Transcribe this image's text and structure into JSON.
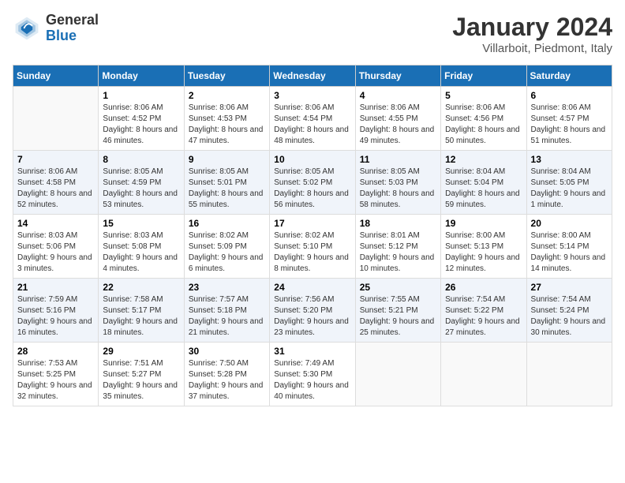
{
  "header": {
    "logo_line1": "General",
    "logo_line2": "Blue",
    "month": "January 2024",
    "location": "Villarboit, Piedmont, Italy"
  },
  "days_of_week": [
    "Sunday",
    "Monday",
    "Tuesday",
    "Wednesday",
    "Thursday",
    "Friday",
    "Saturday"
  ],
  "weeks": [
    [
      {
        "day": "",
        "sunrise": "",
        "sunset": "",
        "daylight": ""
      },
      {
        "day": "1",
        "sunrise": "Sunrise: 8:06 AM",
        "sunset": "Sunset: 4:52 PM",
        "daylight": "Daylight: 8 hours and 46 minutes."
      },
      {
        "day": "2",
        "sunrise": "Sunrise: 8:06 AM",
        "sunset": "Sunset: 4:53 PM",
        "daylight": "Daylight: 8 hours and 47 minutes."
      },
      {
        "day": "3",
        "sunrise": "Sunrise: 8:06 AM",
        "sunset": "Sunset: 4:54 PM",
        "daylight": "Daylight: 8 hours and 48 minutes."
      },
      {
        "day": "4",
        "sunrise": "Sunrise: 8:06 AM",
        "sunset": "Sunset: 4:55 PM",
        "daylight": "Daylight: 8 hours and 49 minutes."
      },
      {
        "day": "5",
        "sunrise": "Sunrise: 8:06 AM",
        "sunset": "Sunset: 4:56 PM",
        "daylight": "Daylight: 8 hours and 50 minutes."
      },
      {
        "day": "6",
        "sunrise": "Sunrise: 8:06 AM",
        "sunset": "Sunset: 4:57 PM",
        "daylight": "Daylight: 8 hours and 51 minutes."
      }
    ],
    [
      {
        "day": "7",
        "sunrise": "Sunrise: 8:06 AM",
        "sunset": "Sunset: 4:58 PM",
        "daylight": "Daylight: 8 hours and 52 minutes."
      },
      {
        "day": "8",
        "sunrise": "Sunrise: 8:05 AM",
        "sunset": "Sunset: 4:59 PM",
        "daylight": "Daylight: 8 hours and 53 minutes."
      },
      {
        "day": "9",
        "sunrise": "Sunrise: 8:05 AM",
        "sunset": "Sunset: 5:01 PM",
        "daylight": "Daylight: 8 hours and 55 minutes."
      },
      {
        "day": "10",
        "sunrise": "Sunrise: 8:05 AM",
        "sunset": "Sunset: 5:02 PM",
        "daylight": "Daylight: 8 hours and 56 minutes."
      },
      {
        "day": "11",
        "sunrise": "Sunrise: 8:05 AM",
        "sunset": "Sunset: 5:03 PM",
        "daylight": "Daylight: 8 hours and 58 minutes."
      },
      {
        "day": "12",
        "sunrise": "Sunrise: 8:04 AM",
        "sunset": "Sunset: 5:04 PM",
        "daylight": "Daylight: 8 hours and 59 minutes."
      },
      {
        "day": "13",
        "sunrise": "Sunrise: 8:04 AM",
        "sunset": "Sunset: 5:05 PM",
        "daylight": "Daylight: 9 hours and 1 minute."
      }
    ],
    [
      {
        "day": "14",
        "sunrise": "Sunrise: 8:03 AM",
        "sunset": "Sunset: 5:06 PM",
        "daylight": "Daylight: 9 hours and 3 minutes."
      },
      {
        "day": "15",
        "sunrise": "Sunrise: 8:03 AM",
        "sunset": "Sunset: 5:08 PM",
        "daylight": "Daylight: 9 hours and 4 minutes."
      },
      {
        "day": "16",
        "sunrise": "Sunrise: 8:02 AM",
        "sunset": "Sunset: 5:09 PM",
        "daylight": "Daylight: 9 hours and 6 minutes."
      },
      {
        "day": "17",
        "sunrise": "Sunrise: 8:02 AM",
        "sunset": "Sunset: 5:10 PM",
        "daylight": "Daylight: 9 hours and 8 minutes."
      },
      {
        "day": "18",
        "sunrise": "Sunrise: 8:01 AM",
        "sunset": "Sunset: 5:12 PM",
        "daylight": "Daylight: 9 hours and 10 minutes."
      },
      {
        "day": "19",
        "sunrise": "Sunrise: 8:00 AM",
        "sunset": "Sunset: 5:13 PM",
        "daylight": "Daylight: 9 hours and 12 minutes."
      },
      {
        "day": "20",
        "sunrise": "Sunrise: 8:00 AM",
        "sunset": "Sunset: 5:14 PM",
        "daylight": "Daylight: 9 hours and 14 minutes."
      }
    ],
    [
      {
        "day": "21",
        "sunrise": "Sunrise: 7:59 AM",
        "sunset": "Sunset: 5:16 PM",
        "daylight": "Daylight: 9 hours and 16 minutes."
      },
      {
        "day": "22",
        "sunrise": "Sunrise: 7:58 AM",
        "sunset": "Sunset: 5:17 PM",
        "daylight": "Daylight: 9 hours and 18 minutes."
      },
      {
        "day": "23",
        "sunrise": "Sunrise: 7:57 AM",
        "sunset": "Sunset: 5:18 PM",
        "daylight": "Daylight: 9 hours and 21 minutes."
      },
      {
        "day": "24",
        "sunrise": "Sunrise: 7:56 AM",
        "sunset": "Sunset: 5:20 PM",
        "daylight": "Daylight: 9 hours and 23 minutes."
      },
      {
        "day": "25",
        "sunrise": "Sunrise: 7:55 AM",
        "sunset": "Sunset: 5:21 PM",
        "daylight": "Daylight: 9 hours and 25 minutes."
      },
      {
        "day": "26",
        "sunrise": "Sunrise: 7:54 AM",
        "sunset": "Sunset: 5:22 PM",
        "daylight": "Daylight: 9 hours and 27 minutes."
      },
      {
        "day": "27",
        "sunrise": "Sunrise: 7:54 AM",
        "sunset": "Sunset: 5:24 PM",
        "daylight": "Daylight: 9 hours and 30 minutes."
      }
    ],
    [
      {
        "day": "28",
        "sunrise": "Sunrise: 7:53 AM",
        "sunset": "Sunset: 5:25 PM",
        "daylight": "Daylight: 9 hours and 32 minutes."
      },
      {
        "day": "29",
        "sunrise": "Sunrise: 7:51 AM",
        "sunset": "Sunset: 5:27 PM",
        "daylight": "Daylight: 9 hours and 35 minutes."
      },
      {
        "day": "30",
        "sunrise": "Sunrise: 7:50 AM",
        "sunset": "Sunset: 5:28 PM",
        "daylight": "Daylight: 9 hours and 37 minutes."
      },
      {
        "day": "31",
        "sunrise": "Sunrise: 7:49 AM",
        "sunset": "Sunset: 5:30 PM",
        "daylight": "Daylight: 9 hours and 40 minutes."
      },
      {
        "day": "",
        "sunrise": "",
        "sunset": "",
        "daylight": ""
      },
      {
        "day": "",
        "sunrise": "",
        "sunset": "",
        "daylight": ""
      },
      {
        "day": "",
        "sunrise": "",
        "sunset": "",
        "daylight": ""
      }
    ]
  ]
}
